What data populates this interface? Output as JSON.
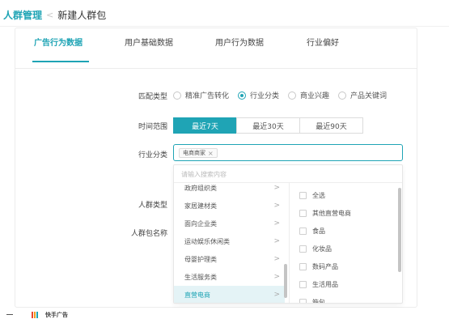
{
  "breadcrumb": {
    "root": "人群管理",
    "separator": "<",
    "current": "新建人群包"
  },
  "tabs": [
    {
      "label": "广告行为数据",
      "active": true
    },
    {
      "label": "用户基础数据",
      "active": false
    },
    {
      "label": "用户行为数据",
      "active": false
    },
    {
      "label": "行业偏好",
      "active": false
    }
  ],
  "form": {
    "match_type_label": "匹配类型",
    "match_options": [
      {
        "label": "精准广告转化",
        "checked": false
      },
      {
        "label": "行业分类",
        "checked": true
      },
      {
        "label": "商业兴趣",
        "checked": false
      },
      {
        "label": "产品关键词",
        "checked": false
      }
    ],
    "time_range_label": "时间范围",
    "time_options": [
      {
        "label": "最近7天",
        "selected": true
      },
      {
        "label": "最近30天",
        "selected": false
      },
      {
        "label": "最近90天",
        "selected": false
      }
    ],
    "industry_label": "行业分类",
    "industry_tag": "电商商家",
    "tag_remove": "×",
    "audience_type_label": "人群类型",
    "package_name_label": "人群包名称"
  },
  "dropdown": {
    "search_placeholder": "请输入搜索内容",
    "categories": [
      {
        "label": "政府组织类",
        "selected": false
      },
      {
        "label": "家居建材类",
        "selected": false
      },
      {
        "label": "面向企业类",
        "selected": false
      },
      {
        "label": "运动娱乐休闲类",
        "selected": false
      },
      {
        "label": "母婴护理类",
        "selected": false
      },
      {
        "label": "生活服务类",
        "selected": false
      },
      {
        "label": "直营电商",
        "selected": true
      }
    ],
    "arrow": ">",
    "subcategories": [
      {
        "label": "全选",
        "checked": false
      },
      {
        "label": "其他直营电商",
        "checked": false
      },
      {
        "label": "食品",
        "checked": false
      },
      {
        "label": "化妆品",
        "checked": false
      },
      {
        "label": "数码产品",
        "checked": false
      },
      {
        "label": "生活用品",
        "checked": false
      },
      {
        "label": "箱包",
        "checked": false
      }
    ]
  },
  "footer": {
    "brand": "快手广告",
    "logo_colors": [
      "#e8472f",
      "#f39c1f",
      "#1fa4b5",
      "#3a7bd5"
    ]
  },
  "colors": {
    "accent": "#1fa4b5",
    "selected_bg": "#e4f3f6"
  }
}
